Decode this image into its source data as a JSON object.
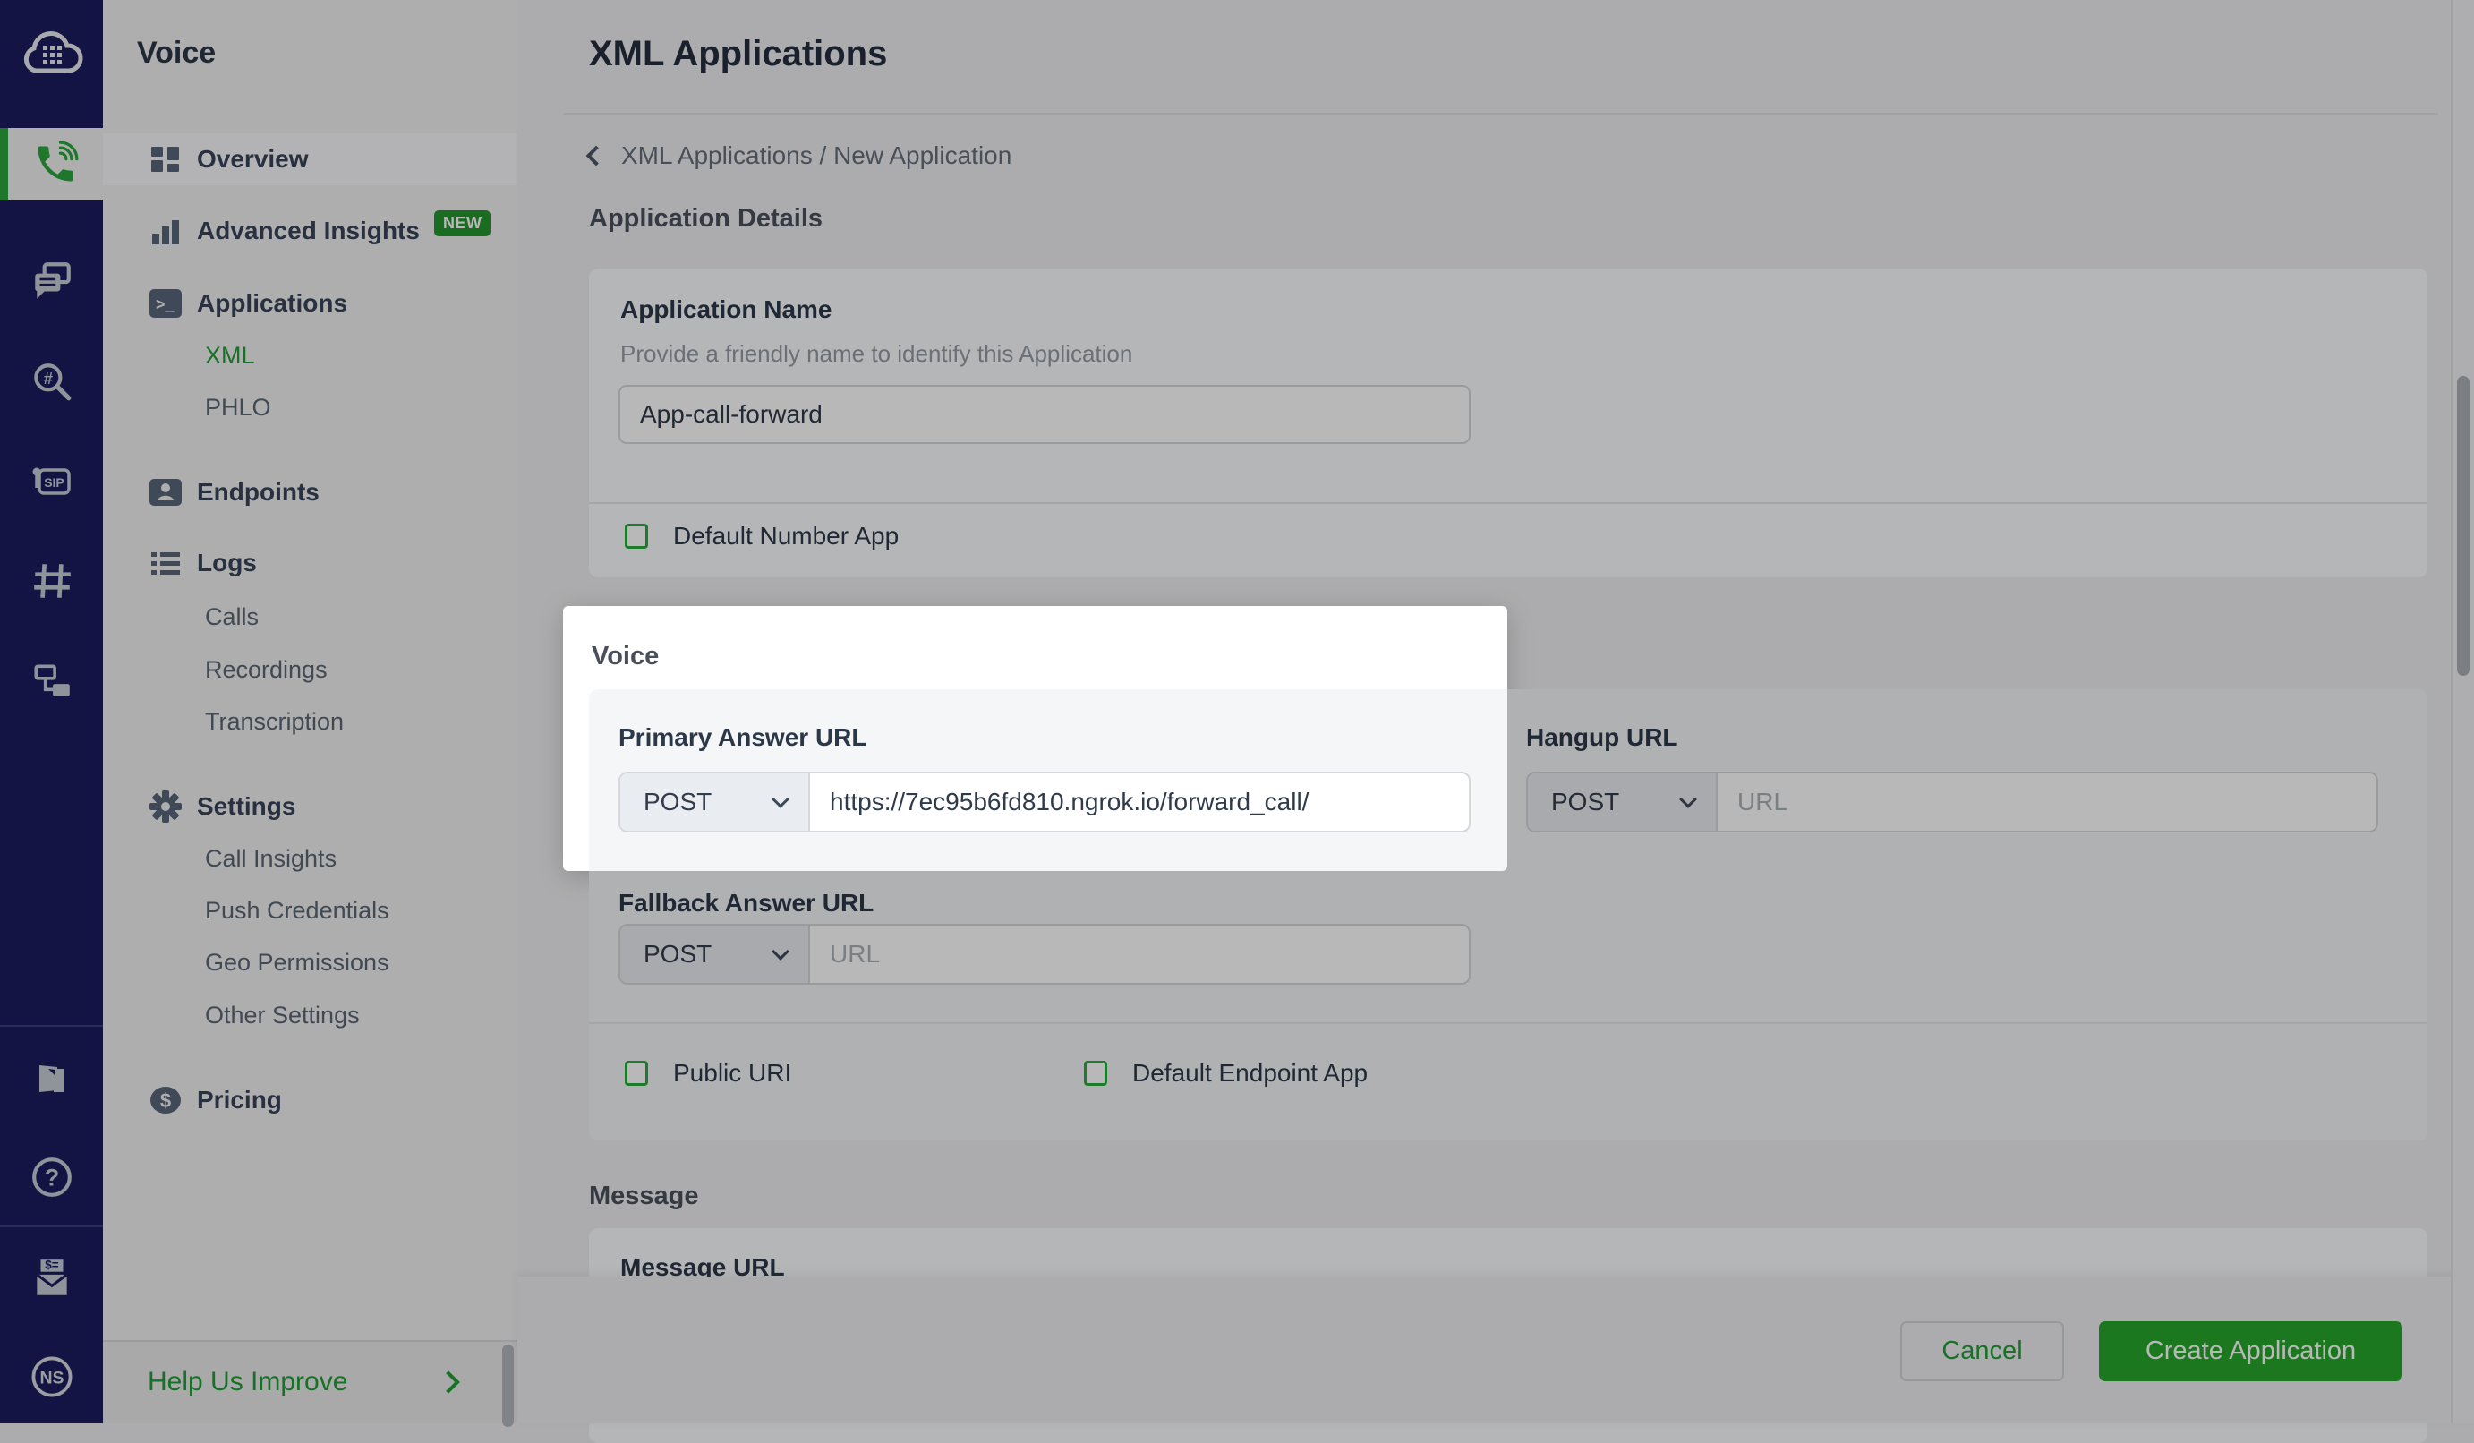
{
  "colors": {
    "rail_navy": "#1b1c5e",
    "accent_green": "#1f9e34",
    "button_green": "#28a72c",
    "badge_green": "#24982d",
    "checkbox_green": "#2cab3e",
    "dim_overlay": "rgba(0,0,0,0.28)",
    "page_bg": "#efeff1",
    "card_bg": "#fbfcfe",
    "voice_card_bg": "#f4f6f8"
  },
  "rail": {
    "icons": [
      "plivo-logo",
      "voice-phone",
      "messaging-chat",
      "number-lookup-search",
      "sip-trunking",
      "phone-numbers-hash",
      "workflow",
      "docs-book",
      "help-question",
      "billing-envelope",
      "account-avatar"
    ],
    "sip_label": "SIP",
    "account_initials": "NS"
  },
  "sidebar": {
    "title": "Voice",
    "items": [
      {
        "label": "Overview"
      },
      {
        "label": "Advanced Insights",
        "badge": "NEW"
      },
      {
        "label": "Applications"
      },
      {
        "label": "XML"
      },
      {
        "label": "PHLO"
      },
      {
        "label": "Endpoints"
      },
      {
        "label": "Logs"
      },
      {
        "label": "Calls"
      },
      {
        "label": "Recordings"
      },
      {
        "label": "Transcription"
      },
      {
        "label": "Settings"
      },
      {
        "label": "Call Insights"
      },
      {
        "label": "Push Credentials"
      },
      {
        "label": "Geo Permissions"
      },
      {
        "label": "Other Settings"
      },
      {
        "label": "Pricing"
      }
    ],
    "help_label": "Help Us Improve"
  },
  "main": {
    "title": "XML Applications",
    "breadcrumb": "XML Applications / New Application",
    "section_app_details": "Application Details",
    "app_name": {
      "label": "Application Name",
      "help": "Provide a friendly name to identify this Application",
      "value": "App-call-forward"
    },
    "default_number_label": "Default Number App",
    "voice": {
      "heading": "Voice",
      "primary": {
        "label": "Primary Answer URL",
        "method": "POST",
        "value": "https://7ec95b6fd810.ngrok.io/forward_call/"
      },
      "hangup": {
        "label": "Hangup URL",
        "method": "POST",
        "placeholder": "URL"
      },
      "fallback": {
        "label": "Fallback Answer URL",
        "method": "POST",
        "placeholder": "URL"
      },
      "public_uri_label": "Public URI",
      "default_endpoint_label": "Default Endpoint App"
    },
    "message": {
      "heading": "Message",
      "url_label": "Message URL"
    }
  },
  "footer": {
    "cancel_label": "Cancel",
    "create_label": "Create Application"
  }
}
